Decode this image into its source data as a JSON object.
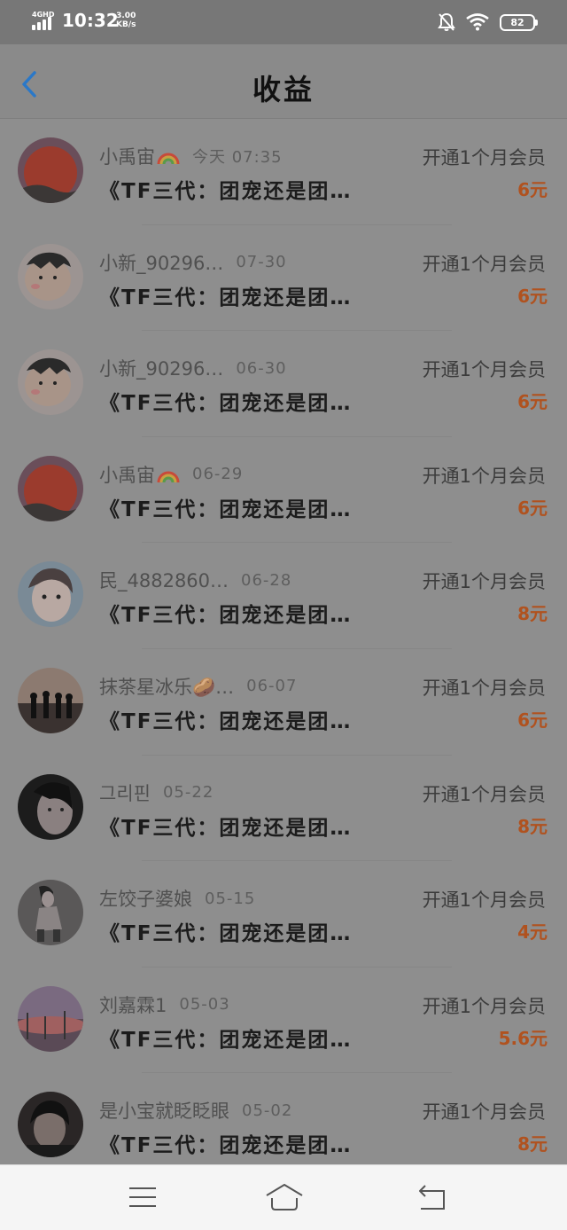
{
  "status_bar": {
    "network": "4GHD",
    "time": "10:32",
    "speed_value": "3.00",
    "speed_unit": "KB/s",
    "battery": "82",
    "icons": [
      "bell-off-icon",
      "wifi-icon",
      "battery-icon"
    ]
  },
  "header": {
    "title": "收益",
    "back_icon": "chevron-left-icon"
  },
  "colors": {
    "accent": "#2a78c8",
    "amount": "#b0521f",
    "overlay_gray": "#8e8e8e"
  },
  "records": [
    {
      "name": "小禹宙",
      "emoji": "rainbow",
      "date": "今天 07:35",
      "topic": "《TF三代：团宠还是团…",
      "action": "开通1个月会员",
      "amount": "6元"
    },
    {
      "name": "小新_90296…",
      "date": "07-30",
      "topic": "《TF三代：团宠还是团…",
      "action": "开通1个月会员",
      "amount": "6元"
    },
    {
      "name": "小新_90296…",
      "date": "06-30",
      "topic": "《TF三代：团宠还是团…",
      "action": "开通1个月会员",
      "amount": "6元"
    },
    {
      "name": "小禹宙",
      "emoji": "rainbow",
      "date": "06-29",
      "topic": "《TF三代：团宠还是团…",
      "action": "开通1个月会员",
      "amount": "6元"
    },
    {
      "name": "民_4882860…",
      "date": "06-28",
      "topic": "《TF三代：团宠还是团…",
      "action": "开通1个月会员",
      "amount": "8元"
    },
    {
      "name": "抹茶星冰乐🥔…",
      "date": "06-07",
      "topic": "《TF三代：团宠还是团…",
      "action": "开通1个月会员",
      "amount": "6元"
    },
    {
      "name": "그리핀",
      "date": "05-22",
      "topic": "《TF三代：团宠还是团…",
      "action": "开通1个月会员",
      "amount": "8元"
    },
    {
      "name": "左饺子婆娘",
      "date": "05-15",
      "topic": "《TF三代：团宠还是团…",
      "action": "开通1个月会员",
      "amount": "4元"
    },
    {
      "name": "刘嘉霖1",
      "date": "05-03",
      "topic": "《TF三代：团宠还是团…",
      "action": "开通1个月会员",
      "amount": "5.6元"
    },
    {
      "name": "是小宝就眨眨眼",
      "date": "05-02",
      "topic": "《TF三代：团宠还是团…",
      "action": "开通1个月会员",
      "amount": "8元"
    }
  ],
  "nav_bar": {
    "icons": [
      "menu-icon",
      "home-icon",
      "back-icon"
    ]
  }
}
